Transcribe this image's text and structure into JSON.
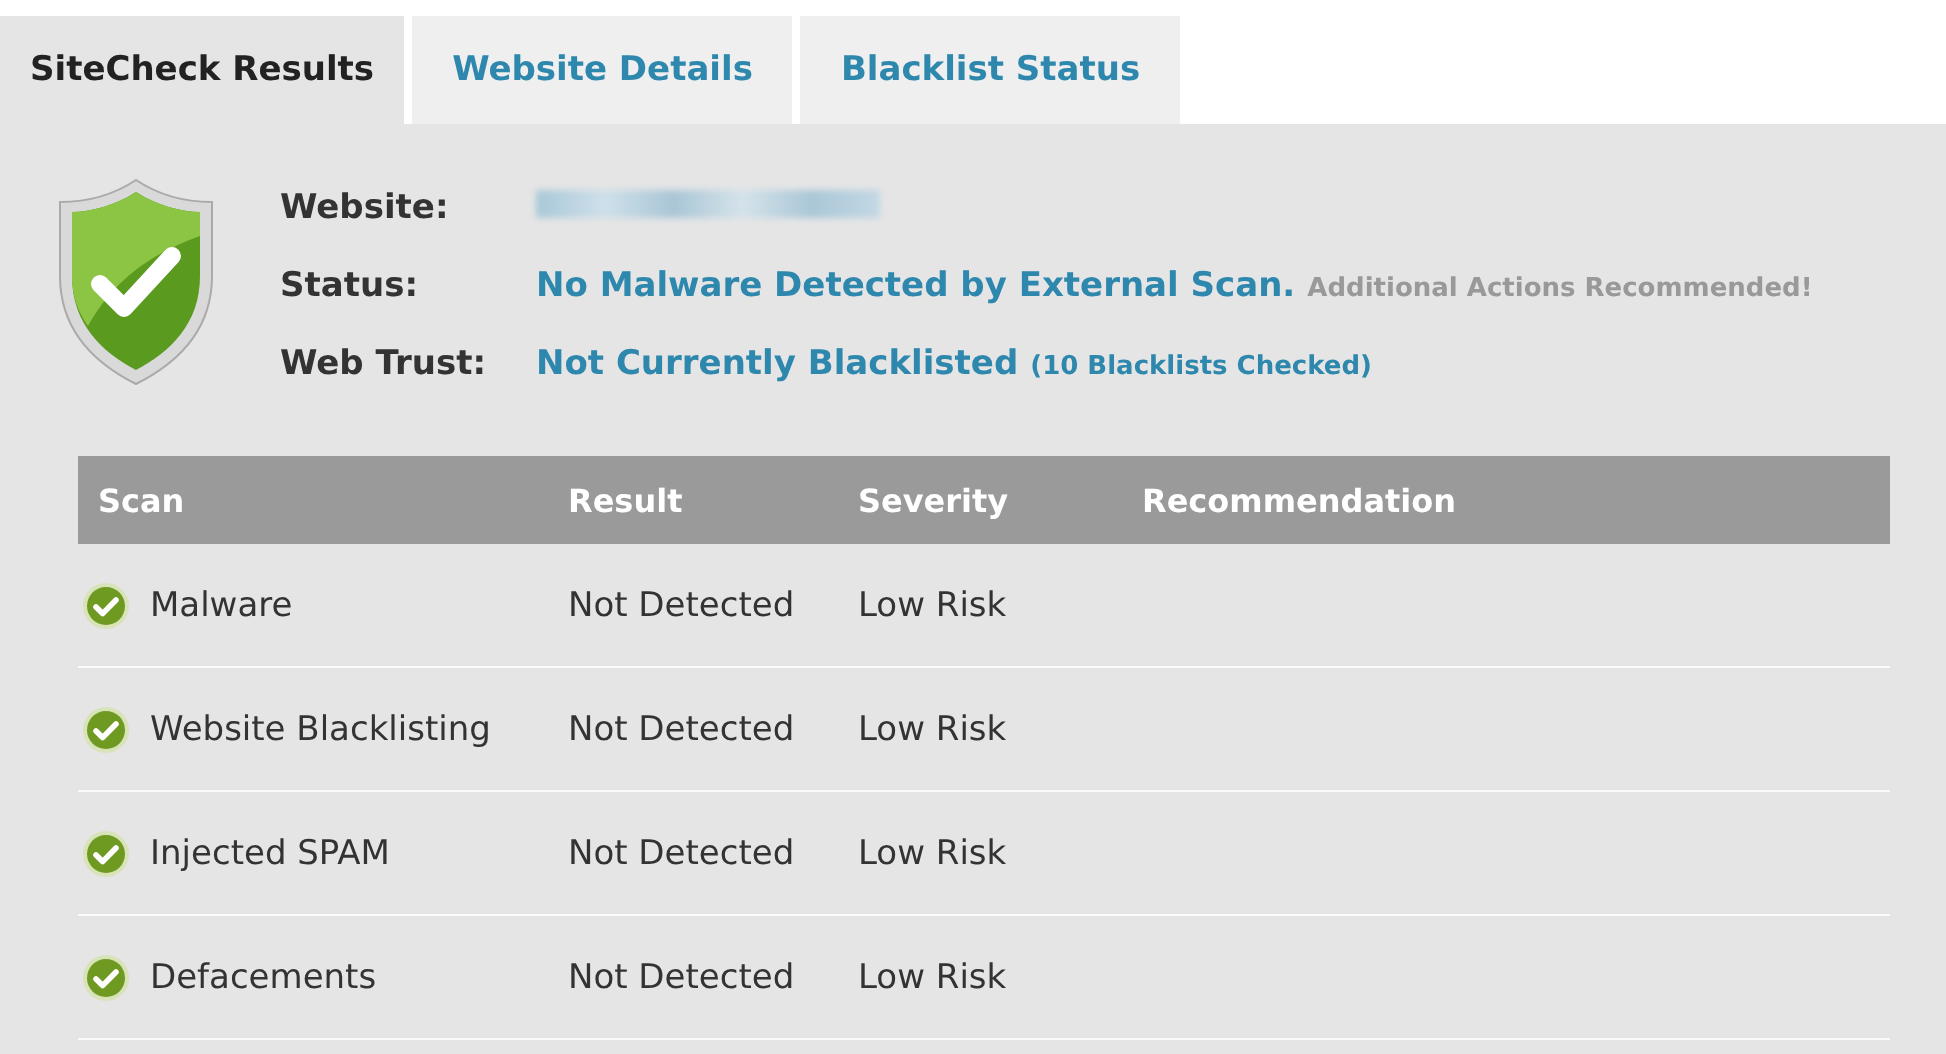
{
  "tabs": [
    {
      "label": "SiteCheck Results",
      "selected": true
    },
    {
      "label": "Website Details",
      "selected": false
    },
    {
      "label": "Blacklist Status",
      "selected": false
    }
  ],
  "summary": {
    "passed": true,
    "rows": [
      {
        "kind": "redacted",
        "label": "Website:"
      },
      {
        "kind": "text",
        "label": "Status:",
        "value": "No Malware Detected by External Scan.",
        "note": {
          "text": "Additional Actions Recommended!",
          "color": "#999999"
        }
      },
      {
        "kind": "text",
        "label": "Web Trust:",
        "value": "Not Currently Blacklisted",
        "note": {
          "text": "(10 Blacklists Checked)",
          "color": "#2e87ad"
        }
      }
    ]
  },
  "table": {
    "columns": [
      "Scan",
      "Result",
      "Severity",
      "Recommendation"
    ],
    "rows": [
      {
        "passed": true,
        "scan": "Malware",
        "result": "Not Detected",
        "severity": "Low Risk"
      },
      {
        "passed": true,
        "scan": "Website Blacklisting",
        "result": "Not Detected",
        "severity": "Low Risk"
      },
      {
        "passed": true,
        "scan": "Injected SPAM",
        "result": "Not Detected",
        "severity": "Low Risk"
      },
      {
        "passed": true,
        "scan": "Defacements",
        "result": "Not Detected",
        "severity": "Low Risk"
      }
    ]
  }
}
